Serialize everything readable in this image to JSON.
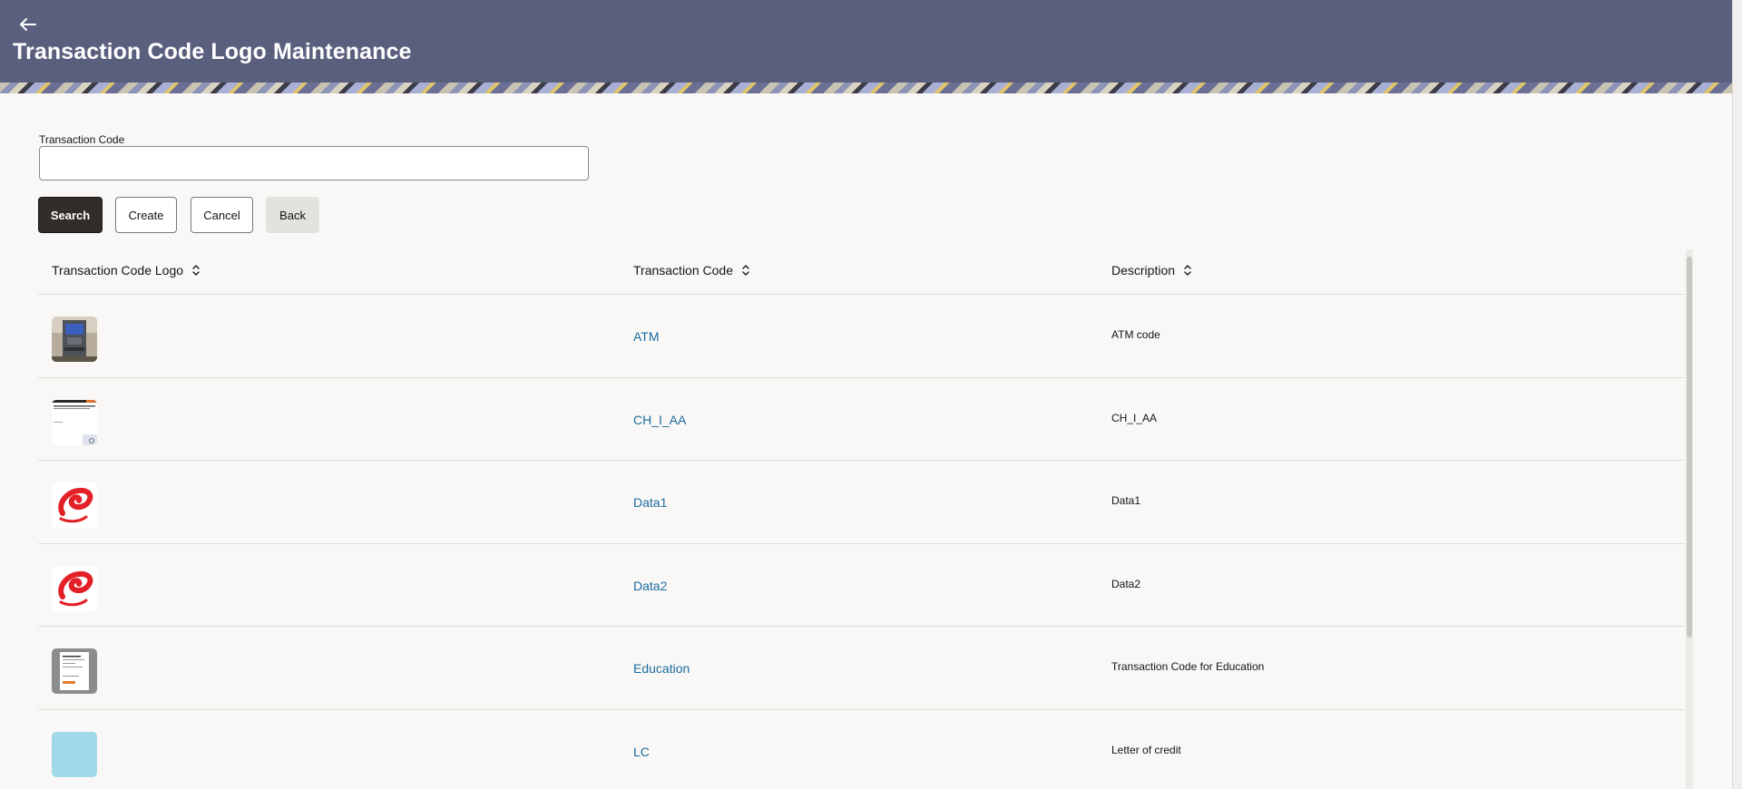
{
  "header": {
    "title": "Transaction Code Logo Maintenance",
    "back_icon": "arrow-left-icon"
  },
  "search": {
    "label": "Transaction Code",
    "value": ""
  },
  "buttons": {
    "search": "Search",
    "create": "Create",
    "cancel": "Cancel",
    "back": "Back"
  },
  "table": {
    "columns": [
      "Transaction Code Logo",
      "Transaction Code",
      "Description"
    ],
    "rows": [
      {
        "logo": "atm-machine-photo",
        "code": "ATM",
        "description": "ATM code"
      },
      {
        "logo": "document-screenshot-thumbnail",
        "code": "CH_I_AA",
        "description": "CH_I_AA"
      },
      {
        "logo": "red-swirl-logo",
        "code": "Data1",
        "description": "Data1"
      },
      {
        "logo": "red-swirl-logo",
        "code": "Data2",
        "description": "Data2"
      },
      {
        "logo": "form-document-thumbnail",
        "code": "Education",
        "description": "Transaction Code for Education"
      },
      {
        "logo": "light-blue-square",
        "code": "LC",
        "description": "Letter of credit"
      }
    ]
  },
  "colors": {
    "header_bg": "#5b5f7e",
    "primary_button": "#312d2a",
    "link": "#1b6ba0",
    "page_bg": "#f9f8f6"
  }
}
